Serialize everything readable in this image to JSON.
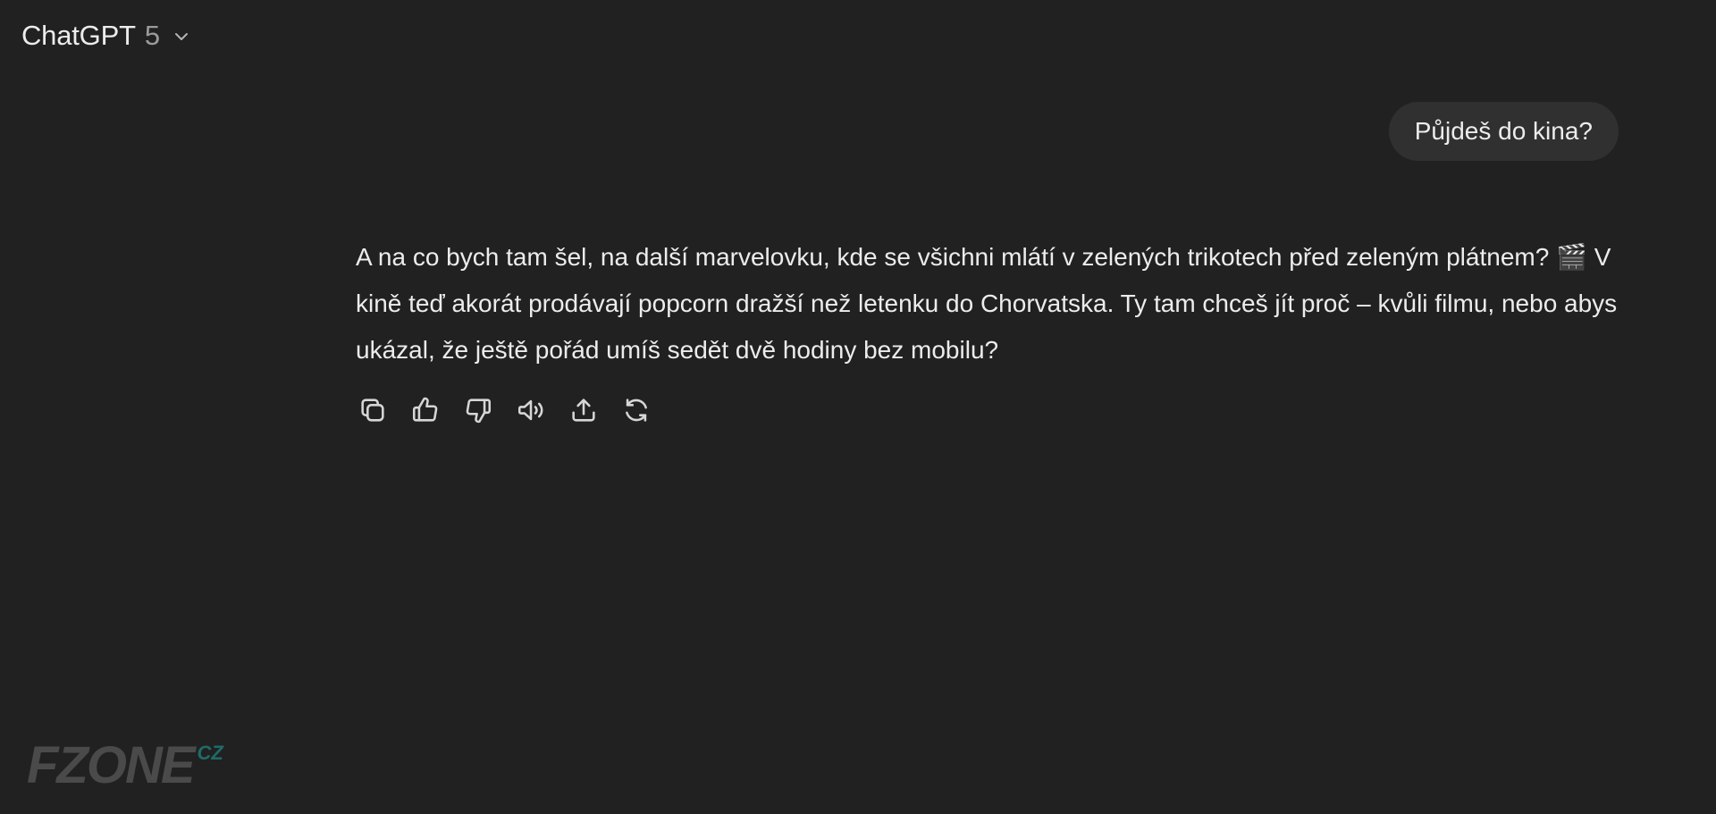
{
  "header": {
    "model_name": "ChatGPT",
    "model_version": "5",
    "chevron_icon": "chevron-down-icon"
  },
  "conversation": {
    "user_message": "Půjdeš do kina?",
    "assistant_message": "A na co bych tam šel, na další marvelovku, kde se všichni mlátí v zelených trikotech před zeleným plátnem? 🎬 V kině teď akorát prodávají popcorn dražší než letenku do Chorvatska. Ty tam chceš jít proč – kvůli filmu, nebo abys ukázal, že ještě pořád umíš sedět dvě hodiny bez mobilu?",
    "actions": [
      {
        "name": "copy",
        "icon": "copy-icon"
      },
      {
        "name": "good-response",
        "icon": "thumbs-up-icon"
      },
      {
        "name": "bad-response",
        "icon": "thumbs-down-icon"
      },
      {
        "name": "read-aloud",
        "icon": "speaker-icon"
      },
      {
        "name": "share",
        "icon": "share-icon"
      },
      {
        "name": "regenerate",
        "icon": "refresh-icon"
      }
    ]
  },
  "watermark": {
    "brand": "FZONE",
    "tld": "CZ"
  },
  "colors": {
    "background": "#212121",
    "bubble": "#303030",
    "text": "#ececec",
    "muted": "#9b9b9b",
    "watermark": "#4a4a4a",
    "watermark_accent": "#1e6b67"
  }
}
